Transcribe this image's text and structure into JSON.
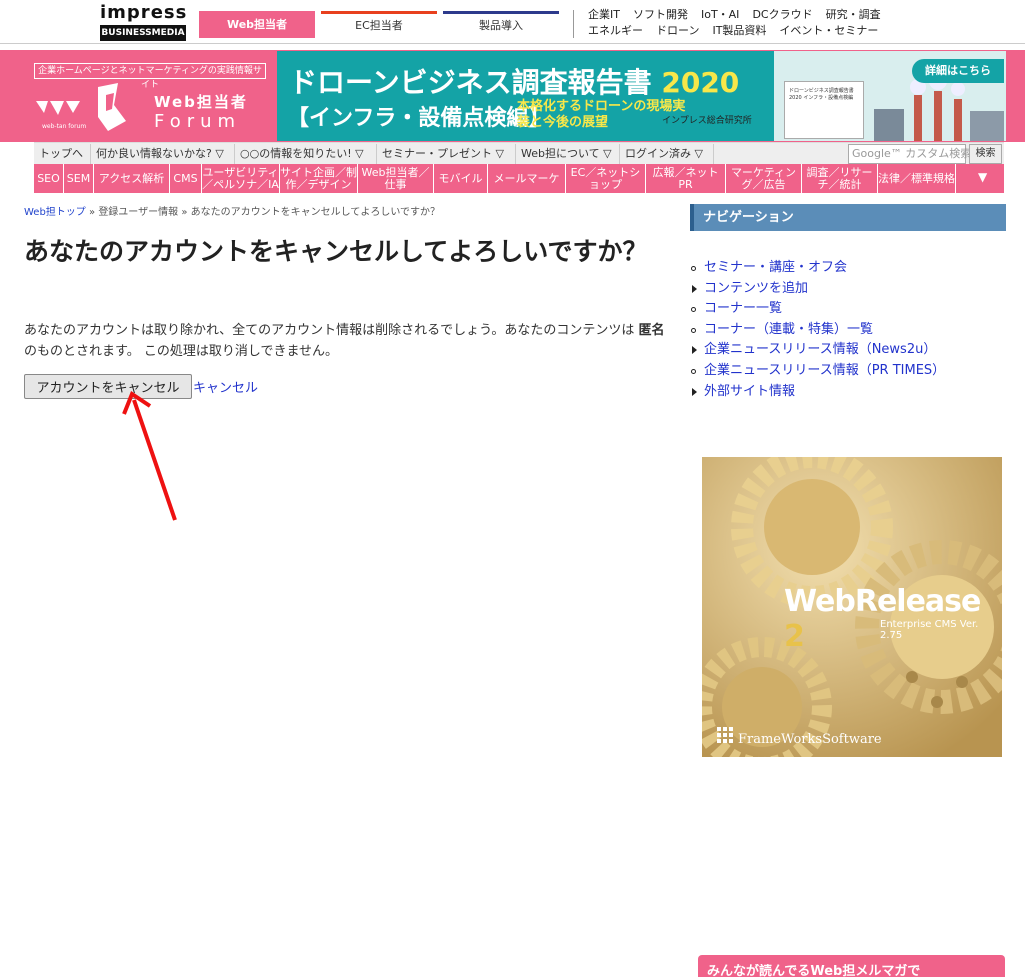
{
  "topbar": {
    "logo_main": "impress",
    "logo_sub": "BUSINESSMEDIA",
    "tabs": [
      {
        "label": "Web担当者"
      },
      {
        "label": "EC担当者"
      },
      {
        "label": "製品導入"
      }
    ],
    "links_row1": [
      "企業IT",
      "ソフト開発",
      "IoT・AI",
      "DCクラウド",
      "研究・調査"
    ],
    "links_row2": [
      "エネルギー",
      "ドローン",
      "IT製品資料",
      "イベント・セミナー"
    ]
  },
  "header": {
    "tagline": "企業ホームページとネットマーケティングの実践情報サイト",
    "logo_title": "Web担当者",
    "logo_sub": "Forum",
    "logo_small": "web-tan forum"
  },
  "ad_banner": {
    "title": "ドローンビジネス調査報告書",
    "year": "2020",
    "subtitle": "【インフラ・設備点検編】",
    "tagline": "本格化するドローンの現場実装と今後の展望",
    "lab": "インプレス総合研究所",
    "detail_button": "詳細はこちら",
    "doc_text": "ドローンビジネス調査報告書2020 インフラ・設備点検編"
  },
  "menubar": {
    "items": [
      {
        "label": "トップへ"
      },
      {
        "label": "何か良い情報ないかな? ▽"
      },
      {
        "label": "○○の情報を知りたい! ▽"
      },
      {
        "label": "セミナー・プレゼント ▽"
      },
      {
        "label": "Web担について ▽"
      },
      {
        "label": "ログイン済み ▽"
      }
    ],
    "search_placeholder": "Google™ カスタム検索",
    "search_button": "検索"
  },
  "catbar": {
    "items": [
      {
        "label": "SEO"
      },
      {
        "label": "SEM"
      },
      {
        "label": "アクセス解析"
      },
      {
        "label": "CMS"
      },
      {
        "label": "ユーザビリティ／ペルソナ／IA"
      },
      {
        "label": "サイト企画／制作／デザイン"
      },
      {
        "label": "Web担当者／仕事"
      },
      {
        "label": "モバイル"
      },
      {
        "label": "メールマーケ"
      },
      {
        "label": "EC／ネットショップ"
      },
      {
        "label": "広報／ネットPR"
      },
      {
        "label": "マーケティング／広告"
      },
      {
        "label": "調査／リサーチ／統計"
      },
      {
        "label": "法律／標準規格"
      }
    ]
  },
  "main": {
    "breadcrumb": {
      "home": "Web担トップ",
      "sep": "»",
      "item1": "登録ユーザー情報",
      "current": "あなたのアカウントをキャンセルしてよろしいですか？"
    },
    "title": "あなたのアカウントをキャンセルしてよろしいですか？",
    "body_part1": "あなたのアカウントは取り除かれ、全てのアカウント情報は削除されるでしょう。あなたのコンテンツは",
    "body_bold": "匿名",
    "body_part2": "のものとされます。 この処理は取り消しできません。",
    "cancel_account_button": "アカウントをキャンセル",
    "cancel_link": "キャンセル"
  },
  "sidebar": {
    "nav_title": "ナビゲーション",
    "nav_items": [
      {
        "label": "セミナー・講座・オフ会",
        "bullet": "dot"
      },
      {
        "label": "コンテンツを追加",
        "bullet": "triangle"
      },
      {
        "label": "コーナー一覧",
        "bullet": "dot"
      },
      {
        "label": "コーナー（連載・特集）一覧",
        "bullet": "dot"
      },
      {
        "label": "企業ニュースリリース情報（News2u）",
        "bullet": "triangle"
      },
      {
        "label": "企業ニュースリリース情報（PR TIMES）",
        "bullet": "dot"
      },
      {
        "label": "外部サイト情報",
        "bullet": "triangle"
      }
    ],
    "ad": {
      "title": "WebRelease",
      "title_num": "2",
      "subtitle": "Enterprise CMS Ver. 2.75",
      "company": "FrameWorksSoftware"
    },
    "mail_box_title": "みんなが読んでるWeb担メルマガで"
  },
  "colors": {
    "brand_pink": "#f0628a",
    "nav_blue": "#5b8db8",
    "link_blue": "#2233cc",
    "teal": "#14a3a6",
    "arrow_red": "#ee1111"
  }
}
